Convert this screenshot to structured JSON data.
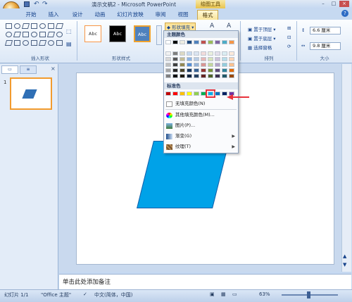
{
  "window": {
    "title": "演示文稿2 - Microsoft PowerPoint",
    "context_title": "绘图工具"
  },
  "tabs": [
    "开始",
    "插入",
    "设计",
    "动画",
    "幻灯片放映",
    "审阅",
    "视图",
    "格式"
  ],
  "ribbon": {
    "group_insert_shapes": "插入形状",
    "group_shape_styles": "形状样式",
    "group_arrange": "排列",
    "group_size": "大小",
    "style_sample": "Abc",
    "shape_fill": "形状填充",
    "bring_front": "置于顶层",
    "send_back": "置于底层",
    "selection_pane": "选择窗格",
    "height_value": "6.6 厘米",
    "width_value": "9.8 厘米"
  },
  "dropdown": {
    "theme_colors_label": "主题颜色",
    "standard_colors_label": "标准色",
    "no_fill": "无填充颜色(N)",
    "more_colors": "其他填充颜色(M)...",
    "picture": "图片(P)...",
    "gradient": "渐变(G)",
    "texture": "纹理(T)",
    "theme_top_row": [
      "#ffffff",
      "#000000",
      "#eeece1",
      "#1f497d",
      "#4f81bd",
      "#c0504d",
      "#9bbb59",
      "#8064a2",
      "#4bacc6",
      "#f79646"
    ],
    "theme_shades": [
      [
        "#f2f2f2",
        "#7f7f7f",
        "#ddd9c3",
        "#c6d9f0",
        "#dbe5f1",
        "#f2dcdb",
        "#ebf1dd",
        "#e5e0ec",
        "#dbeef3",
        "#fdeada"
      ],
      [
        "#d8d8d8",
        "#595959",
        "#c4bd97",
        "#8db3e2",
        "#b8cce4",
        "#e5b9b7",
        "#d7e3bc",
        "#ccc1d9",
        "#b7dde8",
        "#fbd5b5"
      ],
      [
        "#bfbfbf",
        "#3f3f3f",
        "#938953",
        "#548dd4",
        "#95b3d7",
        "#d99694",
        "#c3d69b",
        "#b2a2c7",
        "#92cddc",
        "#fac08f"
      ],
      [
        "#a5a5a5",
        "#262626",
        "#494429",
        "#17365d",
        "#366092",
        "#953734",
        "#76923c",
        "#5f497a",
        "#31859b",
        "#e36c09"
      ],
      [
        "#7f7f7f",
        "#0c0c0c",
        "#1d1b10",
        "#0f243e",
        "#244061",
        "#632423",
        "#4f6128",
        "#3f3151",
        "#205867",
        "#974806"
      ]
    ],
    "standard_colors": [
      "#c00000",
      "#ff0000",
      "#ffc000",
      "#ffff00",
      "#92d050",
      "#00b050",
      "#00b0f0",
      "#0070c0",
      "#002060",
      "#7030a0"
    ],
    "selected_color": "#00b0f0"
  },
  "slide_panel": {
    "slide_number": "1",
    "tab_slides": "幻灯片",
    "tab_outline": "大纲"
  },
  "slide": {
    "shape_fill": "#00a2e8"
  },
  "notes_placeholder": "单击此处添加备注",
  "status": {
    "slide": "幻灯片 1/1",
    "theme": "\"Office 主题\"",
    "language": "中文(简体，中国)",
    "zoom": "63%"
  }
}
